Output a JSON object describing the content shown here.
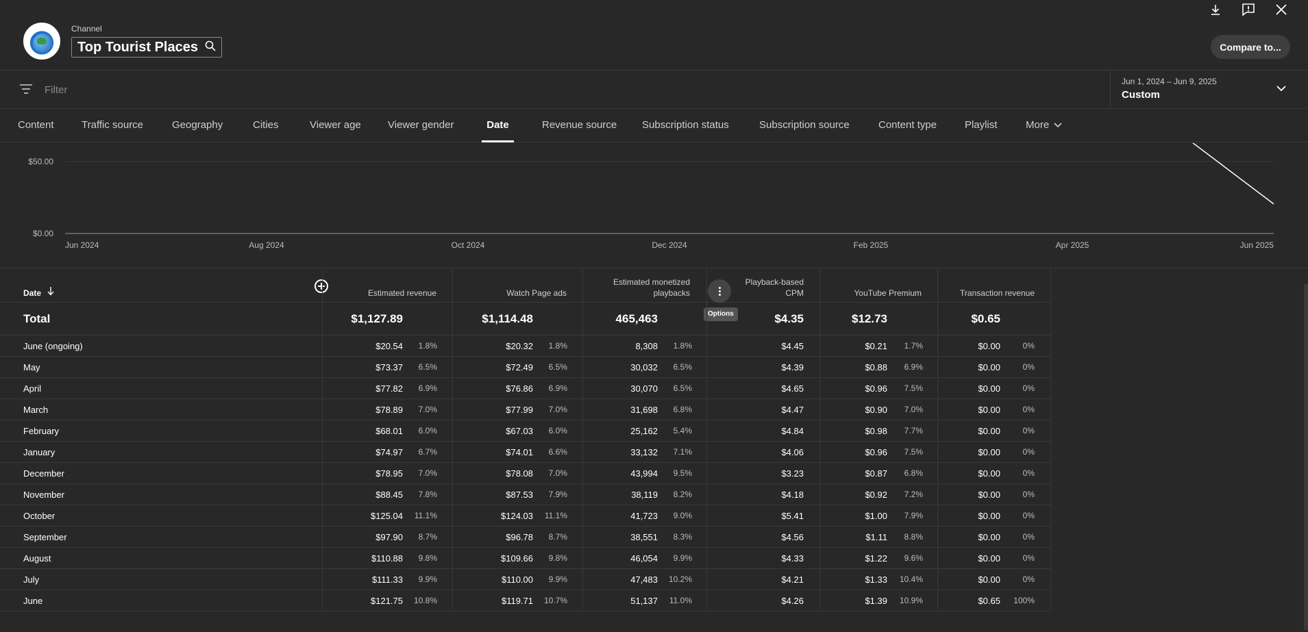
{
  "header": {
    "channel_label": "Channel",
    "channel_name": "Top Tourist Places",
    "logo_text": "Top Tourist Places",
    "compare_label": "Compare to..."
  },
  "filter": {
    "placeholder": "Filter"
  },
  "daterange": {
    "range": "Jun 1, 2024 – Jun 9, 2025",
    "preset": "Custom"
  },
  "tabs": [
    {
      "label": "Content"
    },
    {
      "label": "Traffic source"
    },
    {
      "label": "Geography"
    },
    {
      "label": "Cities"
    },
    {
      "label": "Viewer age"
    },
    {
      "label": "Viewer gender"
    },
    {
      "label": "Date",
      "active": true
    },
    {
      "label": "Revenue source"
    },
    {
      "label": "Subscription status"
    },
    {
      "label": "Subscription source"
    },
    {
      "label": "Content type"
    },
    {
      "label": "Playlist"
    },
    {
      "label": "More"
    }
  ],
  "chart_data": {
    "type": "line",
    "y_ticks": [
      "$50.00",
      "$0.00"
    ],
    "x_ticks": [
      "Jun 2024",
      "Aug 2024",
      "Oct 2024",
      "Dec 2024",
      "Feb 2025",
      "Apr 2025",
      "Jun 2025"
    ],
    "ylim": [
      0,
      50
    ],
    "series": [
      {
        "x": [
          "May 2025",
          "Jun 2025"
        ],
        "y": [
          73.37,
          20.54
        ]
      }
    ]
  },
  "table": {
    "date_header": "Date",
    "options_tooltip": "Options",
    "columns": [
      {
        "header": "Estimated revenue",
        "total": "$1,127.89"
      },
      {
        "header": "Watch Page ads",
        "total": "$1,114.48"
      },
      {
        "header": "Estimated monetized playbacks",
        "total": "465,463"
      },
      {
        "header": "Playback-based CPM",
        "total": "$4.35"
      },
      {
        "header": "YouTube Premium",
        "total": "$12.73"
      },
      {
        "header": "Transaction revenue",
        "total": "$0.65"
      }
    ],
    "total_label": "Total",
    "rows": [
      {
        "label": "June (ongoing)",
        "cells": [
          [
            "$20.54",
            "1.8%"
          ],
          [
            "$20.32",
            "1.8%"
          ],
          [
            "8,308",
            "1.8%"
          ],
          [
            "$4.45",
            ""
          ],
          [
            "$0.21",
            "1.7%"
          ],
          [
            "$0.00",
            "0%"
          ]
        ]
      },
      {
        "label": "May",
        "cells": [
          [
            "$73.37",
            "6.5%"
          ],
          [
            "$72.49",
            "6.5%"
          ],
          [
            "30,032",
            "6.5%"
          ],
          [
            "$4.39",
            ""
          ],
          [
            "$0.88",
            "6.9%"
          ],
          [
            "$0.00",
            "0%"
          ]
        ]
      },
      {
        "label": "April",
        "cells": [
          [
            "$77.82",
            "6.9%"
          ],
          [
            "$76.86",
            "6.9%"
          ],
          [
            "30,070",
            "6.5%"
          ],
          [
            "$4.65",
            ""
          ],
          [
            "$0.96",
            "7.5%"
          ],
          [
            "$0.00",
            "0%"
          ]
        ]
      },
      {
        "label": "March",
        "cells": [
          [
            "$78.89",
            "7.0%"
          ],
          [
            "$77.99",
            "7.0%"
          ],
          [
            "31,698",
            "6.8%"
          ],
          [
            "$4.47",
            ""
          ],
          [
            "$0.90",
            "7.0%"
          ],
          [
            "$0.00",
            "0%"
          ]
        ]
      },
      {
        "label": "February",
        "cells": [
          [
            "$68.01",
            "6.0%"
          ],
          [
            "$67.03",
            "6.0%"
          ],
          [
            "25,162",
            "5.4%"
          ],
          [
            "$4.84",
            ""
          ],
          [
            "$0.98",
            "7.7%"
          ],
          [
            "$0.00",
            "0%"
          ]
        ]
      },
      {
        "label": "January",
        "cells": [
          [
            "$74.97",
            "6.7%"
          ],
          [
            "$74.01",
            "6.6%"
          ],
          [
            "33,132",
            "7.1%"
          ],
          [
            "$4.06",
            ""
          ],
          [
            "$0.96",
            "7.5%"
          ],
          [
            "$0.00",
            "0%"
          ]
        ]
      },
      {
        "label": "December",
        "cells": [
          [
            "$78.95",
            "7.0%"
          ],
          [
            "$78.08",
            "7.0%"
          ],
          [
            "43,994",
            "9.5%"
          ],
          [
            "$3.23",
            ""
          ],
          [
            "$0.87",
            "6.8%"
          ],
          [
            "$0.00",
            "0%"
          ]
        ]
      },
      {
        "label": "November",
        "cells": [
          [
            "$88.45",
            "7.8%"
          ],
          [
            "$87.53",
            "7.9%"
          ],
          [
            "38,119",
            "8.2%"
          ],
          [
            "$4.18",
            ""
          ],
          [
            "$0.92",
            "7.2%"
          ],
          [
            "$0.00",
            "0%"
          ]
        ]
      },
      {
        "label": "October",
        "cells": [
          [
            "$125.04",
            "11.1%"
          ],
          [
            "$124.03",
            "11.1%"
          ],
          [
            "41,723",
            "9.0%"
          ],
          [
            "$5.41",
            ""
          ],
          [
            "$1.00",
            "7.9%"
          ],
          [
            "$0.00",
            "0%"
          ]
        ]
      },
      {
        "label": "September",
        "cells": [
          [
            "$97.90",
            "8.7%"
          ],
          [
            "$96.78",
            "8.7%"
          ],
          [
            "38,551",
            "8.3%"
          ],
          [
            "$4.56",
            ""
          ],
          [
            "$1.11",
            "8.8%"
          ],
          [
            "$0.00",
            "0%"
          ]
        ]
      },
      {
        "label": "August",
        "cells": [
          [
            "$110.88",
            "9.8%"
          ],
          [
            "$109.66",
            "9.8%"
          ],
          [
            "46,054",
            "9.9%"
          ],
          [
            "$4.33",
            ""
          ],
          [
            "$1.22",
            "9.6%"
          ],
          [
            "$0.00",
            "0%"
          ]
        ]
      },
      {
        "label": "July",
        "cells": [
          [
            "$111.33",
            "9.9%"
          ],
          [
            "$110.00",
            "9.9%"
          ],
          [
            "47,483",
            "10.2%"
          ],
          [
            "$4.21",
            ""
          ],
          [
            "$1.33",
            "10.4%"
          ],
          [
            "$0.00",
            "0%"
          ]
        ]
      },
      {
        "label": "June",
        "cells": [
          [
            "$121.75",
            "10.8%"
          ],
          [
            "$119.71",
            "10.7%"
          ],
          [
            "51,137",
            "11.0%"
          ],
          [
            "$4.26",
            ""
          ],
          [
            "$1.39",
            "10.9%"
          ],
          [
            "$0.65",
            "100%"
          ]
        ]
      }
    ]
  }
}
